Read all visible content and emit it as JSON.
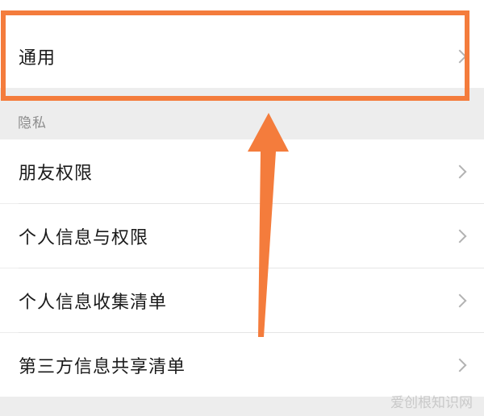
{
  "general": {
    "label": "通用"
  },
  "privacy": {
    "header": "隐私",
    "items": [
      {
        "label": "朋友权限"
      },
      {
        "label": "个人信息与权限"
      },
      {
        "label": "个人信息收集清单"
      },
      {
        "label": "第三方信息共享清单"
      }
    ]
  },
  "icons": {
    "row_arrow": "chevron-right-icon",
    "annotation": "arrow-up-icon"
  },
  "colors": {
    "highlight": "#f47c3c",
    "background": "#ededed",
    "row": "#ffffff"
  },
  "watermark": "爱创根知识网"
}
